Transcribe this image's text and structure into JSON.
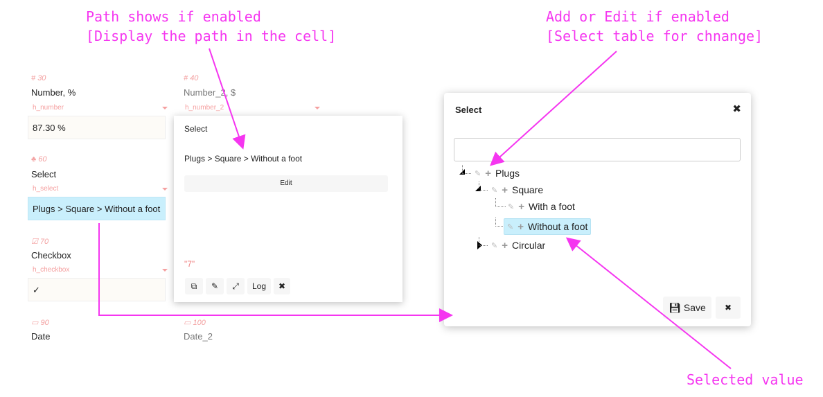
{
  "annotations": {
    "path_title": "Path shows if enabled",
    "path_sub": "[Display the path in the cell]",
    "add_title": "Add or Edit if enabled",
    "add_sub": "[Select table for chnange]",
    "selected": "Selected value",
    "color": "#f536f0"
  },
  "fields": [
    {
      "id": "30",
      "label": "Number, %",
      "hint": "h_number",
      "value": "87.30 %",
      "icon": "hash-icon"
    },
    {
      "id": "40",
      "label": "Number_2, $",
      "hint": "h_number_2",
      "icon": "hash-icon"
    },
    {
      "id": "60",
      "label": "Select",
      "hint": "h_select",
      "value": "Plugs > Square > Without a foot",
      "icon": "tree-icon"
    },
    {
      "id": "70",
      "label": "Checkbox",
      "hint": "h_checkbox",
      "value": "✓",
      "icon": "checkbox-icon"
    },
    {
      "id": "90",
      "label": "Date",
      "icon": "calendar-icon"
    },
    {
      "id": "100",
      "label": "Date_2",
      "icon": "calendar-icon"
    }
  ],
  "popup": {
    "title": "Select",
    "path": "Plugs > Square > Without a foot",
    "edit": "Edit",
    "raw": "\"7\"",
    "log": "Log"
  },
  "modal": {
    "title": "Select",
    "search_value": "",
    "save": "Save",
    "tree": [
      {
        "label": "Plugs"
      },
      {
        "label": "Square"
      },
      {
        "label": "With a foot"
      },
      {
        "label": "Without a foot",
        "selected": true
      },
      {
        "label": "Circular"
      }
    ],
    "selected_bg": "#c9effc"
  }
}
